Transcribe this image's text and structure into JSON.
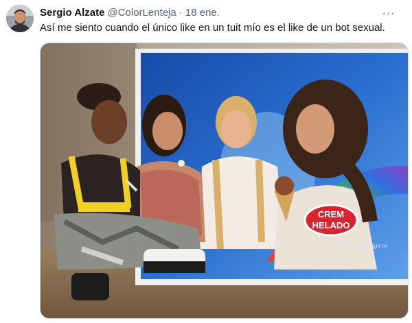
{
  "tweet": {
    "author_name": "Sergio Alzate",
    "handle": "@ColorLenteja",
    "separator": "·",
    "date": "18 ene.",
    "more_glyph": "···",
    "text": "Así me siento cuando el único like en un tuit mío es el like de un bot sexual."
  },
  "media": {
    "poster_brand_line1": "CREM",
    "poster_brand_line2": "HELADO",
    "poster_tagline": "Momentos mágicos"
  },
  "colors": {
    "text_primary": "#0f1419",
    "text_secondary": "#536471",
    "poster_blue": "#1f5fc2",
    "brand_red": "#d9242f"
  },
  "icons": {
    "more": "more-options-icon"
  }
}
